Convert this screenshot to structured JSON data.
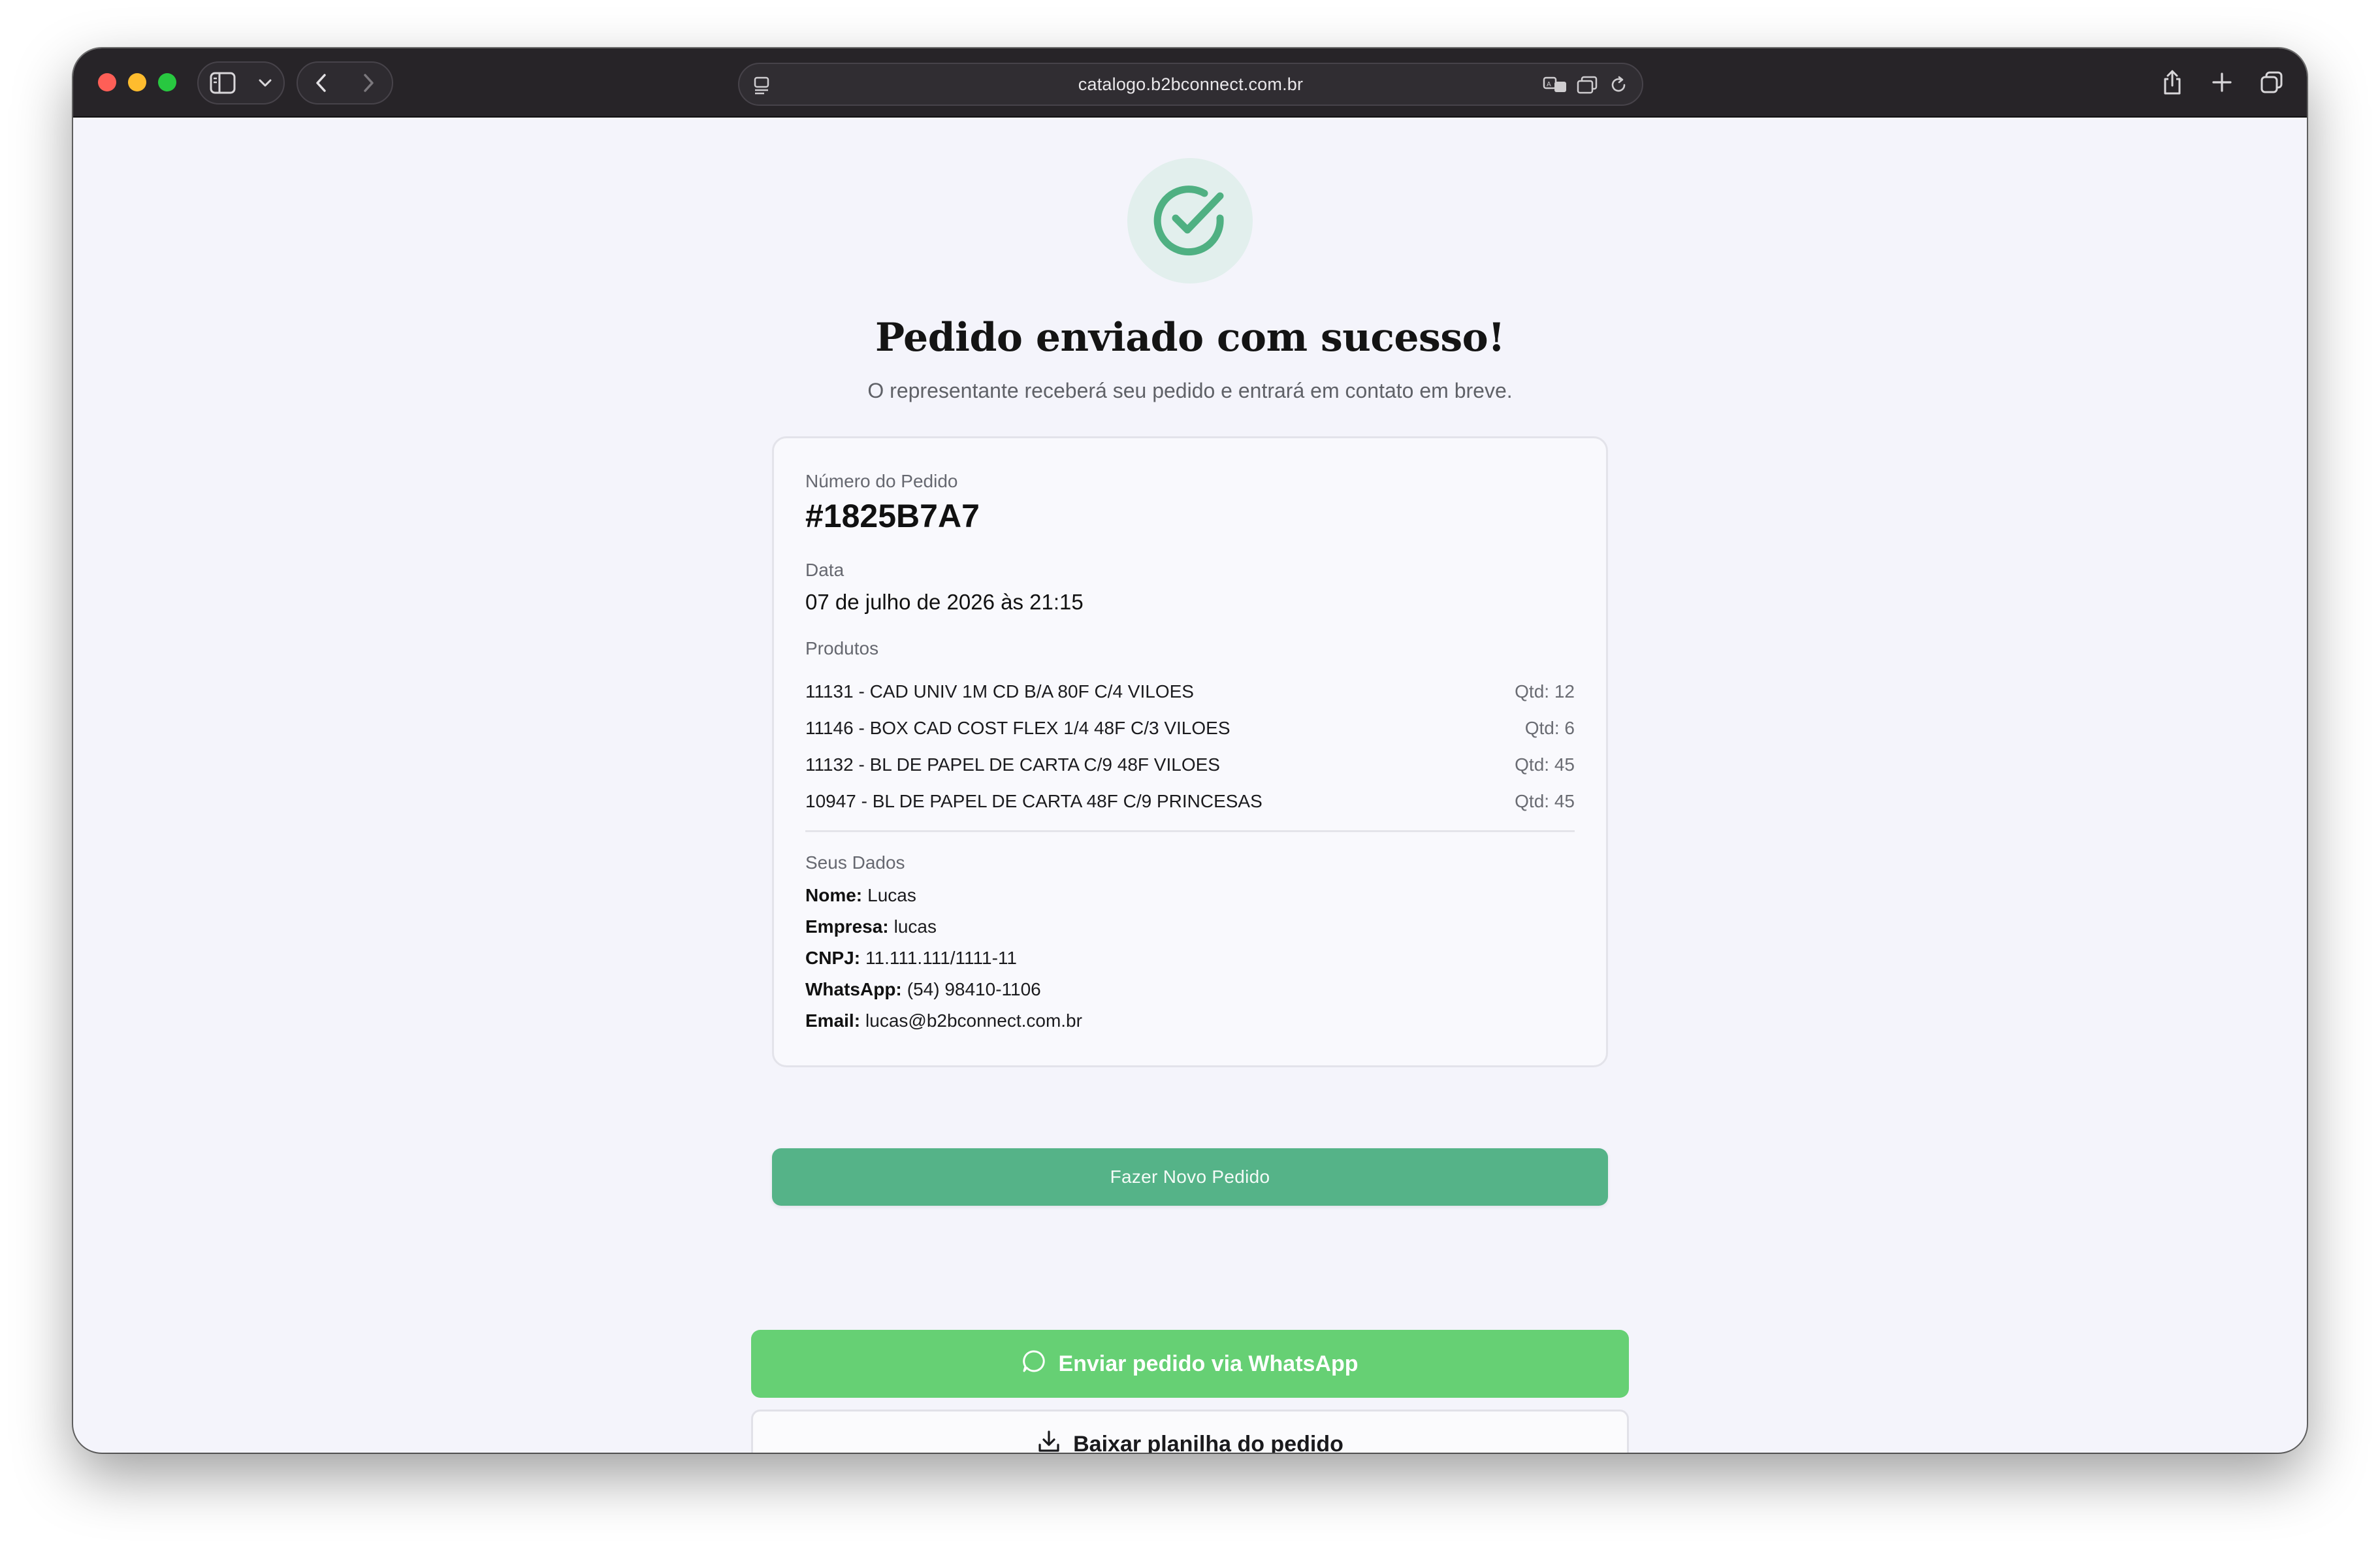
{
  "browser": {
    "url": "catalogo.b2bconnect.com.br",
    "icons": {
      "sidebar": "sidebar-icon",
      "chevron": "chevron-down-icon",
      "back": "back-arrow-icon",
      "forward": "forward-arrow-icon",
      "page": "page-menu-icon",
      "translate": "translate-icon",
      "tabs_overview": "reader-icon",
      "reload": "reload-icon",
      "share": "share-icon",
      "new_tab": "plus-icon",
      "tab_overview": "tabs-icon"
    },
    "traffic_colors": {
      "close": "#fe5f57",
      "minimize": "#febc2e",
      "zoom": "#28c840"
    }
  },
  "success": {
    "icon": "check-circle-icon",
    "title": "Pedido enviado com sucesso!",
    "subtitle": "O representante receberá seu pedido e entrará em contato em breve."
  },
  "order": {
    "number_label": "Número do Pedido",
    "number": "#1825B7A7",
    "date_label": "Data",
    "date": "07 de julho de 2026 às 21:15",
    "products_label": "Produtos",
    "products": [
      {
        "name": "11131 - CAD UNIV 1M CD B/A 80F C/4 VILOES",
        "qty": "Qtd: 12"
      },
      {
        "name": "11146 - BOX CAD COST FLEX 1/4 48F C/3 VILOES",
        "qty": "Qtd: 6"
      },
      {
        "name": "11132 - BL DE PAPEL DE CARTA C/9 48F VILOES",
        "qty": "Qtd: 45"
      },
      {
        "name": "10947 - BL DE PAPEL DE CARTA 48F C/9 PRINCESAS",
        "qty": "Qtd: 45"
      }
    ],
    "customer_label": "Seus Dados",
    "customer": [
      {
        "key": "Nome:",
        "value": "Lucas"
      },
      {
        "key": "Empresa:",
        "value": "lucas"
      },
      {
        "key": "CNPJ:",
        "value": "11.111.111/1111-11"
      },
      {
        "key": "WhatsApp:",
        "value": "(54) 98410-1106"
      },
      {
        "key": "Email:",
        "value": "lucas@b2bconnect.com.br"
      }
    ]
  },
  "actions": {
    "new_order": "Fazer Novo Pedido",
    "whatsapp": "Enviar pedido via WhatsApp",
    "whatsapp_icon": "chat-bubble-icon",
    "download": "Baixar planilha do pedido",
    "download_icon": "download-icon"
  },
  "colors": {
    "primary_green": "#55b388",
    "whatsapp_green": "#66d074",
    "check_green": "#4fb082"
  }
}
